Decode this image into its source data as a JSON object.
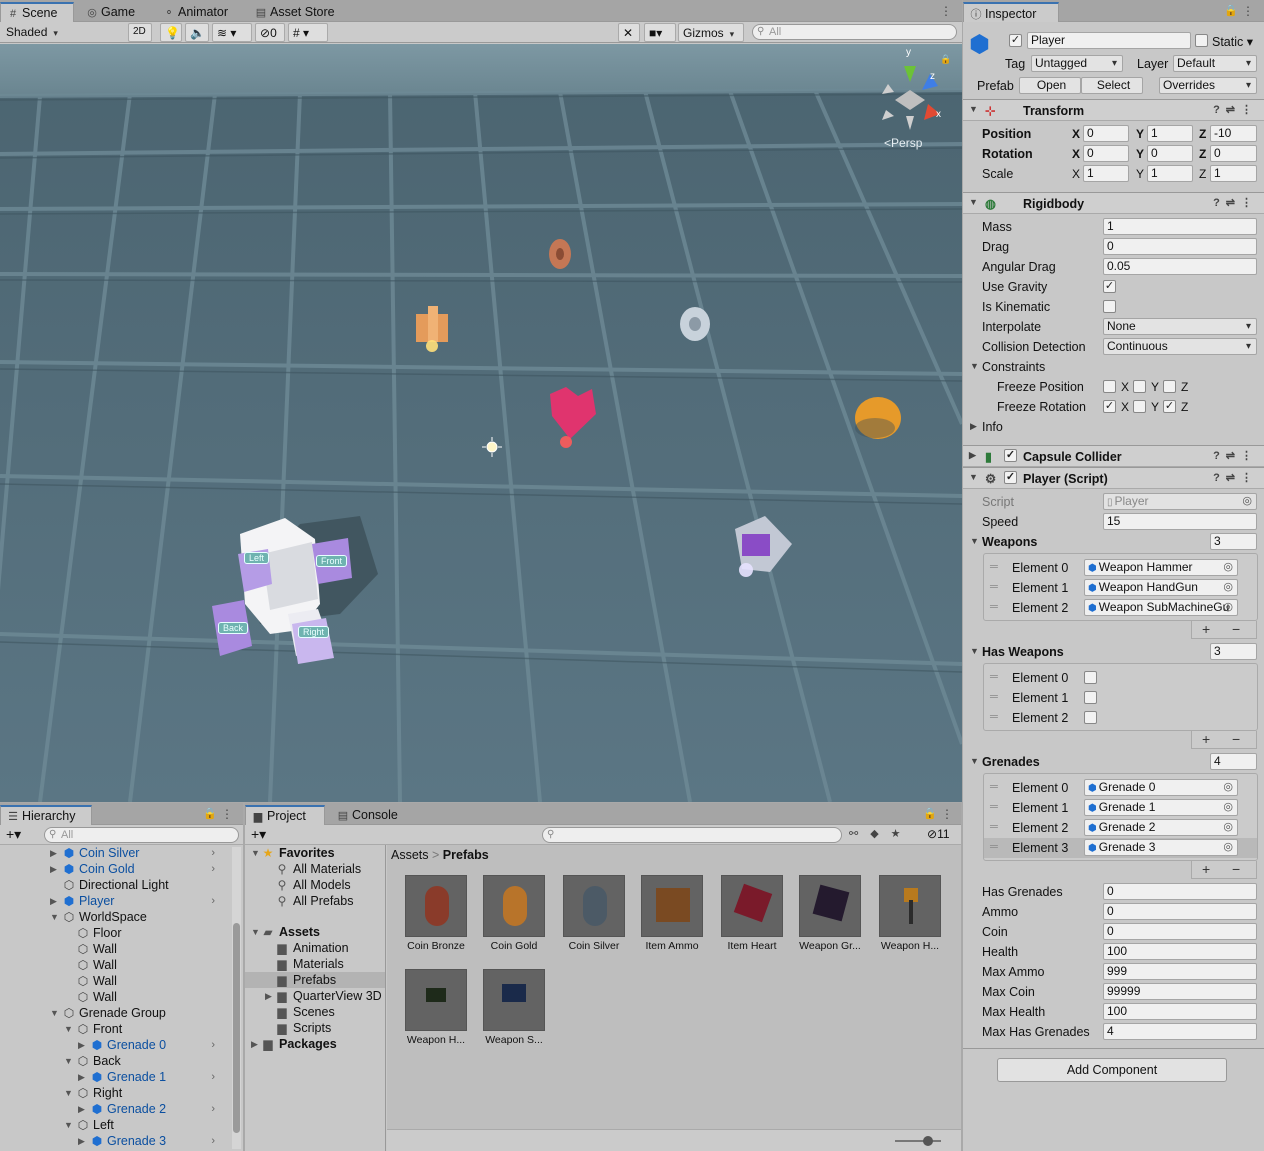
{
  "scene": {
    "tabs": {
      "scene": "Scene",
      "game": "Game",
      "animator": "Animator",
      "asset_store": "Asset Store"
    },
    "toolbar": {
      "shading": "Shaded",
      "mode_2d": "2D",
      "hidden_count": "0",
      "gizmos": "Gizmos",
      "search_placeholder": "All"
    },
    "view": {
      "persp": "Persp",
      "axis_y": "y",
      "axis_z": "z",
      "axis_x": "x"
    },
    "labels": {
      "left": "Left",
      "front": "Front",
      "back": "Back",
      "right": "Right"
    }
  },
  "hierarchy": {
    "title": "Hierarchy",
    "search_placeholder": "All",
    "items": [
      {
        "label": "Coin Silver"
      },
      {
        "label": "Coin Gold"
      },
      {
        "label": "Directional Light"
      },
      {
        "label": "Player"
      },
      {
        "label": "WorldSpace"
      },
      {
        "label": "Floor"
      },
      {
        "label": "Wall"
      },
      {
        "label": "Wall"
      },
      {
        "label": "Wall"
      },
      {
        "label": "Wall"
      },
      {
        "label": "Grenade Group"
      },
      {
        "label": "Front"
      },
      {
        "label": "Grenade 0"
      },
      {
        "label": "Back"
      },
      {
        "label": "Grenade 1"
      },
      {
        "label": "Right"
      },
      {
        "label": "Grenade 2"
      },
      {
        "label": "Left"
      },
      {
        "label": "Grenade 3"
      }
    ]
  },
  "project": {
    "tabs": {
      "project": "Project",
      "console": "Console"
    },
    "hidden_count": "11",
    "tree": {
      "favorites": "Favorites",
      "all_materials": "All Materials",
      "all_models": "All Models",
      "all_prefabs": "All Prefabs",
      "assets": "Assets",
      "animation": "Animation",
      "materials": "Materials",
      "prefabs": "Prefabs",
      "quarterview": "QuarterView 3D",
      "scenes": "Scenes",
      "scripts": "Scripts",
      "packages": "Packages"
    },
    "breadcrumb": {
      "root": "Assets",
      "sep": ">",
      "current": "Prefabs"
    },
    "assets": [
      {
        "name": "Coin Bronze"
      },
      {
        "name": "Coin Gold"
      },
      {
        "name": "Coin Silver"
      },
      {
        "name": "Item Ammo"
      },
      {
        "name": "Item Heart"
      },
      {
        "name": "Weapon Gr..."
      },
      {
        "name": "Weapon H..."
      },
      {
        "name": "Weapon H..."
      },
      {
        "name": "Weapon S..."
      }
    ]
  },
  "inspector": {
    "title": "Inspector",
    "object": {
      "name": "Player",
      "static": "Static",
      "tag_label": "Tag",
      "tag": "Untagged",
      "layer_label": "Layer",
      "layer": "Default",
      "prefab_label": "Prefab",
      "open": "Open",
      "select": "Select",
      "overrides": "Overrides"
    },
    "transform": {
      "title": "Transform",
      "position_label": "Position",
      "rotation_label": "Rotation",
      "scale_label": "Scale",
      "x": "X",
      "y": "Y",
      "z": "Z",
      "position": {
        "x": "0",
        "y": "1",
        "z": "-10"
      },
      "rotation": {
        "x": "0",
        "y": "0",
        "z": "0"
      },
      "scale": {
        "x": "1",
        "y": "1",
        "z": "1"
      }
    },
    "rigidbody": {
      "title": "Rigidbody",
      "mass_label": "Mass",
      "mass": "1",
      "drag_label": "Drag",
      "drag": "0",
      "angular_drag_label": "Angular Drag",
      "angular_drag": "0.05",
      "use_gravity_label": "Use Gravity",
      "is_kinematic_label": "Is Kinematic",
      "interpolate_label": "Interpolate",
      "interpolate": "None",
      "collision_label": "Collision Detection",
      "collision": "Continuous",
      "constraints_label": "Constraints",
      "freeze_position_label": "Freeze Position",
      "freeze_rotation_label": "Freeze Rotation",
      "info_label": "Info"
    },
    "capsule": {
      "title": "Capsule Collider"
    },
    "player_script": {
      "title": "Player (Script)",
      "script_label": "Script",
      "script": "Player",
      "speed_label": "Speed",
      "speed": "15",
      "weapons_label": "Weapons",
      "weapons_count": "3",
      "weapons": [
        {
          "el": "Element 0",
          "val": "Weapon Hammer"
        },
        {
          "el": "Element 1",
          "val": "Weapon HandGun"
        },
        {
          "el": "Element 2",
          "val": "Weapon SubMachineGu"
        }
      ],
      "has_weapons_label": "Has Weapons",
      "has_weapons_count": "3",
      "has_weapons": [
        {
          "el": "Element 0"
        },
        {
          "el": "Element 1"
        },
        {
          "el": "Element 2"
        }
      ],
      "grenades_label": "Grenades",
      "grenades_count": "4",
      "grenades": [
        {
          "el": "Element 0",
          "val": "Grenade 0"
        },
        {
          "el": "Element 1",
          "val": "Grenade 1"
        },
        {
          "el": "Element 2",
          "val": "Grenade 2"
        },
        {
          "el": "Element 3",
          "val": "Grenade 3"
        }
      ],
      "plus": "+",
      "minus": "−",
      "stats": [
        {
          "label": "Has Grenades",
          "val": "0"
        },
        {
          "label": "Ammo",
          "val": "0"
        },
        {
          "label": "Coin",
          "val": "0"
        },
        {
          "label": "Health",
          "val": "100"
        },
        {
          "label": "Max Ammo",
          "val": "999"
        },
        {
          "label": "Max Coin",
          "val": "99999"
        },
        {
          "label": "Max Health",
          "val": "100"
        },
        {
          "label": "Max Has Grenades",
          "val": "4"
        }
      ]
    },
    "add_component": "Add Component"
  }
}
